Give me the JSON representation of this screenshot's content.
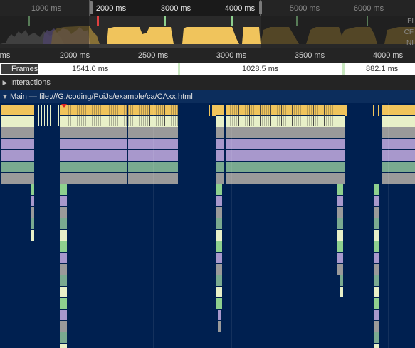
{
  "overview": {
    "ticks": [
      {
        "label": "1000 ms",
        "active": false
      },
      {
        "label": "2000 ms",
        "active": true
      },
      {
        "label": "3000 ms",
        "active": true
      },
      {
        "label": "4000 ms",
        "active": true
      },
      {
        "label": "5000 ms",
        "active": false
      },
      {
        "label": "6000 ms",
        "active": false
      }
    ],
    "lane_labels": [
      "FI",
      "CF",
      "NI"
    ]
  },
  "ruler": {
    "ticks": [
      "ms",
      "2000 ms",
      "2500 ms",
      "3000 ms",
      "3500 ms",
      "4000 ms"
    ]
  },
  "frames": {
    "label": "Frames",
    "values": [
      "1541.0 ms",
      "1028.5 ms",
      "882.1 ms"
    ]
  },
  "interactions": {
    "label": "Interactions"
  },
  "main": {
    "label": "Main — file:///G:/coding/PoiJs/example/ca/CAxx.html"
  },
  "colors": {
    "background": "#002050",
    "scripting": "#f0c45c",
    "task_light": "#e8f0c8",
    "system": "#9a9a9a",
    "painting": "#a898cc",
    "rendering": "#7aaa90",
    "green_marker": "#8ed08e",
    "frame_separator": "#c9e8c0"
  }
}
